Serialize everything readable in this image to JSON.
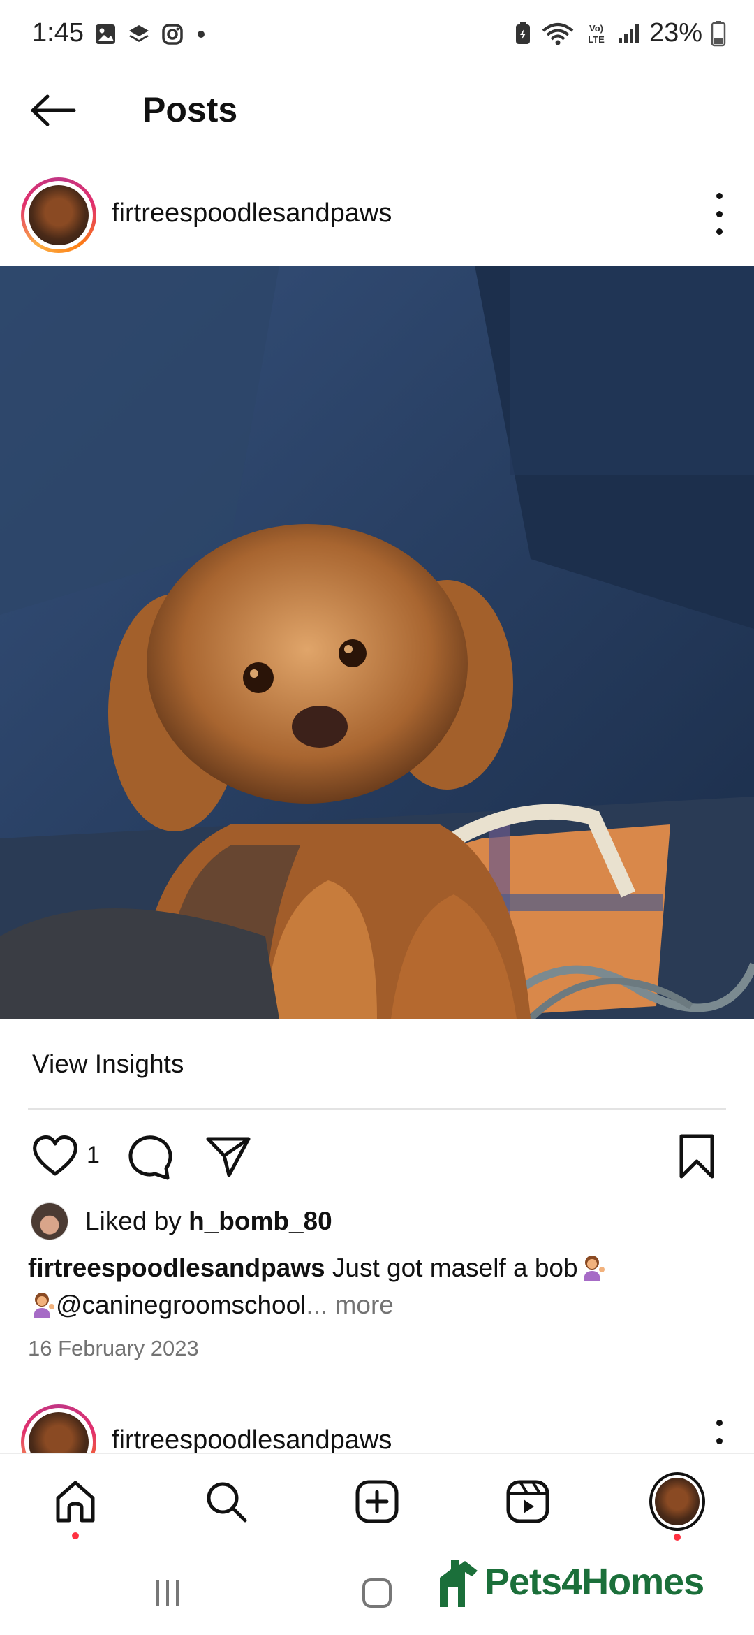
{
  "status_bar": {
    "time": "1:45",
    "battery_percent": "23%",
    "network_label": "VoLTE"
  },
  "header": {
    "title": "Posts"
  },
  "post": {
    "username": "firtreespoodlesandpaws",
    "view_insights": "View Insights",
    "like_count": "1",
    "liked_by_prefix": "Liked by ",
    "liked_by_user": "h_bomb_80",
    "caption_user": "firtreespoodlesandpaws",
    "caption_text_1": " Just got maself a bob",
    "caption_text_2": "@caninegroomschool",
    "caption_ellipsis": "... more",
    "date": "16 February 2023"
  },
  "next_post": {
    "username": "firtreespoodlesandpaws"
  },
  "watermark": "Pets4Homes",
  "colors": {
    "notification_dot": "#ff3040",
    "story_ring": "#e1306c",
    "watermark_green": "#1b6f3a"
  }
}
